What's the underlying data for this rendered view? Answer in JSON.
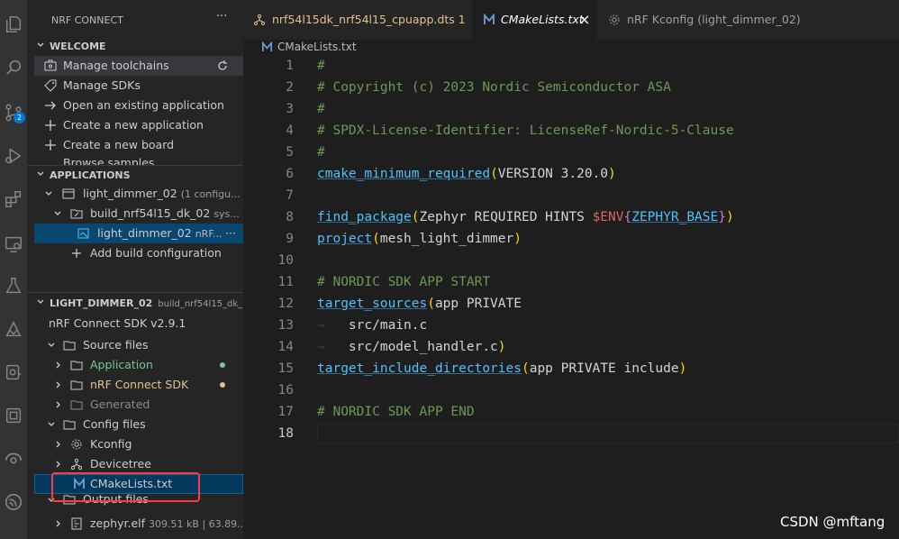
{
  "activity_bar": {
    "icons": [
      "explorer-icon",
      "search-icon",
      "source-control-icon",
      "run-debug-icon",
      "extensions-icon",
      "remote-explorer-icon",
      "testing-icon",
      "nordic-icon",
      "device-icon",
      "board-icon",
      "network-icon",
      "esp-icon"
    ],
    "scm_badge": "2"
  },
  "sidebar": {
    "title": "NRF CONNECT",
    "more": "···",
    "welcome": {
      "header": "WELCOME",
      "items": [
        "Manage toolchains",
        "Manage SDKs",
        "Open an existing application",
        "Create a new application",
        "Create a new board",
        "Browse samples"
      ]
    },
    "applications": {
      "header": "APPLICATIONS",
      "app_name": "light_dimmer_02",
      "app_desc": "(1 configu...",
      "build_name": "build_nrf54l15_dk_02",
      "build_desc": "sys...",
      "image_name": "light_dimmer_02",
      "image_desc": "nRF...",
      "image_more": "···",
      "add_build": "Add build configuration"
    },
    "details": {
      "header": "LIGHT_DIMMER_02",
      "header_desc": "build_nrf54l15_dk_...",
      "sdk": "nRF Connect SDK v2.9.1",
      "source_files": "Source files",
      "application": "Application",
      "nrf_sdk": "nRF Connect SDK",
      "generated": "Generated",
      "config_files": "Config files",
      "kconfig": "Kconfig",
      "devicetree": "Devicetree",
      "cmakelists": "CMakeLists.txt",
      "output_files": "Output files",
      "zephyr_elf": "zephyr.elf",
      "zephyr_desc": "309.51 kB | 63.89..."
    }
  },
  "tabs": [
    {
      "label": "nrf54l15dk_nrf54l15_cpuapp.dts",
      "badge": "1",
      "state": "inactive"
    },
    {
      "label": "CMakeLists.txt",
      "close": "×",
      "state": "active"
    },
    {
      "label": "nRF Kconfig (light_dimmer_02)",
      "state": "inactive"
    }
  ],
  "breadcrumb": "CMakeLists.txt",
  "editor": {
    "line_numbers": [
      "1",
      "2",
      "3",
      "4",
      "5",
      "6",
      "7",
      "8",
      "9",
      "10",
      "11",
      "12",
      "13",
      "14",
      "15",
      "16",
      "17",
      "18"
    ],
    "lines": {
      "l1": "#",
      "l2": "# Copyright (c) 2023 Nordic Semiconductor ASA",
      "l3": "#",
      "l4": "# SPDX-License-Identifier: LicenseRef-Nordic-5-Clause",
      "l5": "#",
      "l6_fn": "cmake_minimum_required",
      "l6_args": "VERSION 3.20.0",
      "l8_fn": "find_package",
      "l8_args": "Zephyr REQUIRED HINTS ",
      "l8_var": "$ENV",
      "l8_inner": "ZEPHYR_BASE",
      "l9_fn": "project",
      "l9_args": "mesh_light_dimmer",
      "l11": "# NORDIC SDK APP START",
      "l12_fn": "target_sources",
      "l12_args": "app PRIVATE",
      "l13": "src/main.c",
      "l14": "src/model_handler.c",
      "l15_fn": "target_include_directories",
      "l15_args": "app PRIVATE include",
      "l17": "# NORDIC SDK APP END"
    }
  },
  "watermark": "CSDN @mftang",
  "colors": {
    "accent": "#0078d4",
    "highlight_box": "#ff3b3b",
    "app_green": "#73c991",
    "sdk_yellow": "#e2c08d"
  }
}
